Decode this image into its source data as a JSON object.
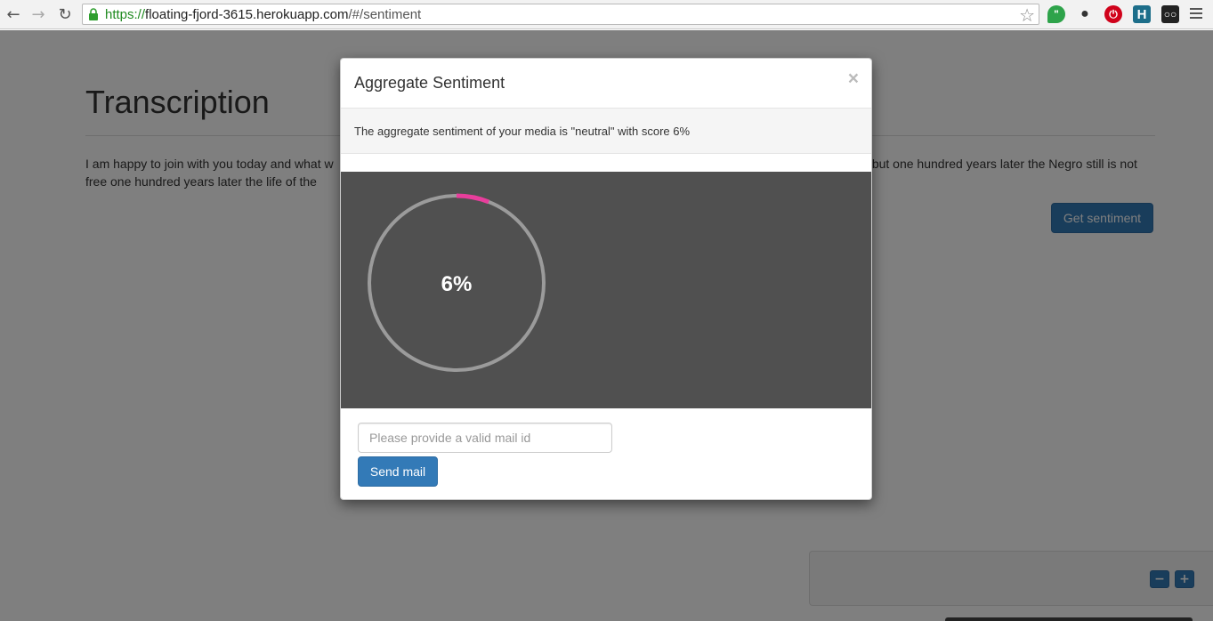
{
  "browser": {
    "url_scheme": "https://",
    "url_host": "floating-fjord-3615.herokuapp.com",
    "url_path": "/#/sentiment"
  },
  "page": {
    "title": "Transcription",
    "transcript_text": "I am happy to join with you today and what w                                                                                                                                                        ic but one hundred years later the Negro still is not free one hundred years later the life of the",
    "get_sentiment_label": "Get sentiment",
    "zoom_out_label": "−",
    "zoom_in_label": "+"
  },
  "modal": {
    "title": "Aggregate Sentiment",
    "close_label": "×",
    "message": "The aggregate sentiment of your media is \"neutral\" with score 6%",
    "gauge": {
      "value": 6,
      "label": "6%",
      "track_color": "#9b9b9b",
      "progress_color": "#e83e9c"
    },
    "mail_placeholder": "Please provide a valid mail id",
    "send_label": "Send mail"
  },
  "colors": {
    "primary": "#337ab7",
    "backdrop": "rgba(0,0,0,0.5)"
  }
}
